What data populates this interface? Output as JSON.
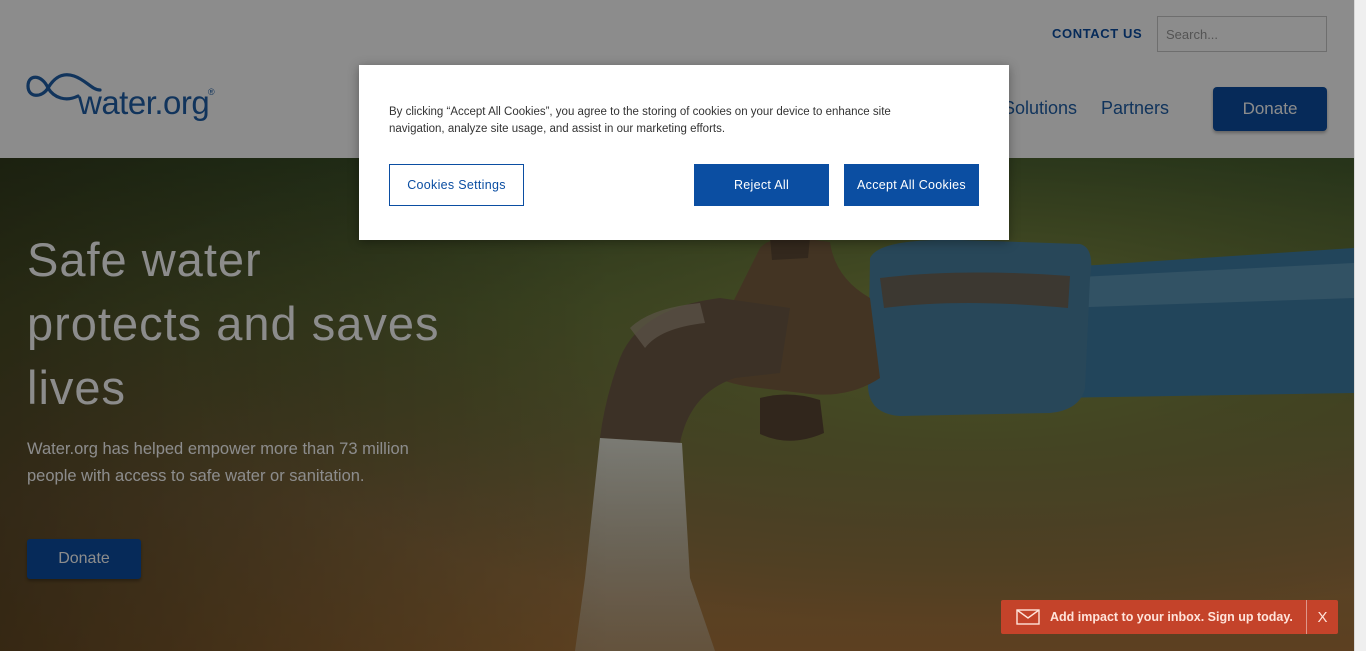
{
  "header": {
    "contact_label": "CONTACT US",
    "search_placeholder": "Search...",
    "logo_text": "water.org",
    "logo_mark": "®",
    "nav": {
      "solutions": "Solutions",
      "partners": "Partners"
    },
    "donate_label": "Donate"
  },
  "hero": {
    "title": "Safe water protects and saves lives",
    "subtitle": "Water.org has helped empower more than 73 million people with access to safe water or sanitation.",
    "donate_label": "Donate"
  },
  "signup_bar": {
    "icon": "mail-icon",
    "text": "Add impact to your inbox. Sign up today.",
    "close_label": "X"
  },
  "cookie_modal": {
    "message": "By clicking “Accept All Cookies”, you agree to the storing of cookies on your device to enhance site navigation, analyze site usage, and assist in our marketing efforts.",
    "settings_label": "Cookies Settings",
    "reject_label": "Reject All",
    "accept_label": "Accept All Cookies"
  },
  "colors": {
    "brand_blue": "#0b4ea2",
    "signup_red": "#c4432a"
  }
}
